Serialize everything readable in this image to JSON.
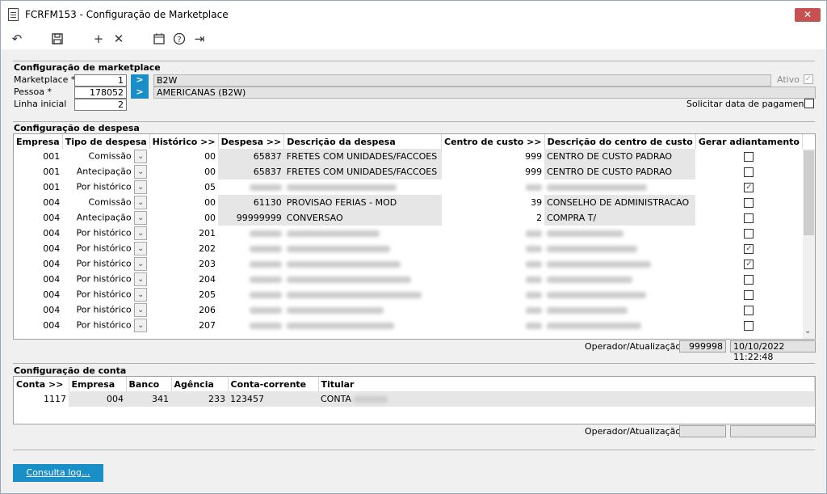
{
  "window": {
    "title": "FCRFM153 - Configuração de Marketplace",
    "close_label": "✕"
  },
  "toolbar": {
    "undo": "↶",
    "save": "💾",
    "add": "+",
    "delete": "✕",
    "calendar": "📅",
    "help": "?",
    "exit": "⇥"
  },
  "marketplace": {
    "section_title": "Configuração de marketplace",
    "marketplace_label": "Marketplace *",
    "marketplace_value": "1",
    "marketplace_desc": "B2W",
    "pessoa_label": "Pessoa *",
    "pessoa_value": "178052",
    "pessoa_desc": "AMERICANAS (B2W)",
    "linha_label": "Linha inicial",
    "linha_value": "2",
    "ativo_label": "Ativo",
    "ativo_checked": true,
    "solicitar_label": "Solicitar data de pagamento",
    "solicitar_checked": false,
    "go_label": ">"
  },
  "despesa": {
    "section_title": "Configuração de despesa",
    "headers": [
      "Empresa",
      "Tipo de despesa",
      "Histórico >>",
      "Despesa >>",
      "Descrição da despesa",
      "Centro de custo >>",
      "Descrição do centro de custo",
      "Gerar adiantamento"
    ],
    "rows": [
      {
        "empresa": "001",
        "tipo": "Comissão",
        "historico": "00",
        "despesa": "65837",
        "descricao": "FRETES COM UNIDADES/FACCOES",
        "centro": "999",
        "desc_centro": "CENTRO DE CUSTO PADRAO",
        "gerar": false
      },
      {
        "empresa": "001",
        "tipo": "Antecipação",
        "historico": "00",
        "despesa": "65837",
        "descricao": "FRETES COM UNIDADES/FACCOES",
        "centro": "999",
        "desc_centro": "CENTRO DE CUSTO PADRAO",
        "gerar": false
      },
      {
        "empresa": "001",
        "tipo": "Por histórico",
        "historico": "05",
        "despesa": "",
        "descricao": "",
        "centro": "",
        "desc_centro": "",
        "gerar": true
      },
      {
        "empresa": "004",
        "tipo": "Comissão",
        "historico": "00",
        "despesa": "61130",
        "descricao": "PROVISAO FERIAS - MOD",
        "centro": "39",
        "desc_centro": "CONSELHO DE ADMINISTRACAO",
        "gerar": false
      },
      {
        "empresa": "004",
        "tipo": "Antecipação",
        "historico": "00",
        "despesa": "99999999",
        "descricao": "CONVERSAO",
        "centro": "2",
        "desc_centro": "COMPRA T/",
        "gerar": false
      },
      {
        "empresa": "004",
        "tipo": "Por histórico",
        "historico": "201",
        "despesa": "",
        "descricao": "",
        "centro": "",
        "desc_centro": "",
        "gerar": false
      },
      {
        "empresa": "004",
        "tipo": "Por histórico",
        "historico": "202",
        "despesa": "",
        "descricao": "",
        "centro": "",
        "desc_centro": "",
        "gerar": true
      },
      {
        "empresa": "004",
        "tipo": "Por histórico",
        "historico": "203",
        "despesa": "",
        "descricao": "",
        "centro": "",
        "desc_centro": "",
        "gerar": true
      },
      {
        "empresa": "004",
        "tipo": "Por histórico",
        "historico": "204",
        "despesa": "",
        "descricao": "",
        "centro": "",
        "desc_centro": "",
        "gerar": false
      },
      {
        "empresa": "004",
        "tipo": "Por histórico",
        "historico": "205",
        "despesa": "",
        "descricao": "",
        "centro": "",
        "desc_centro": "",
        "gerar": false
      },
      {
        "empresa": "004",
        "tipo": "Por histórico",
        "historico": "206",
        "despesa": "",
        "descricao": "",
        "centro": "",
        "desc_centro": "",
        "gerar": false
      },
      {
        "empresa": "004",
        "tipo": "Por histórico",
        "historico": "207",
        "despesa": "",
        "descricao": "",
        "centro": "",
        "desc_centro": "",
        "gerar": false
      }
    ],
    "operador_label": "Operador/Atualização",
    "operador_value": "999998",
    "data_value": "10/10/2022 11:22:48"
  },
  "conta": {
    "section_title": "Configuração de conta",
    "headers": [
      "Conta >>",
      "Empresa",
      "Banco",
      "Agência",
      "Conta-corrente",
      "Titular"
    ],
    "rows": [
      {
        "conta": "1117",
        "empresa": "004",
        "banco": "341",
        "agencia": "233",
        "corrente": "123457",
        "titular": "CONTA"
      }
    ],
    "operador_label": "Operador/Atualização",
    "operador_value": "",
    "data_value": ""
  },
  "footer": {
    "log_button": "Consulta log..."
  },
  "colors": {
    "accent": "#1a8fc7",
    "close": "#c75050"
  }
}
